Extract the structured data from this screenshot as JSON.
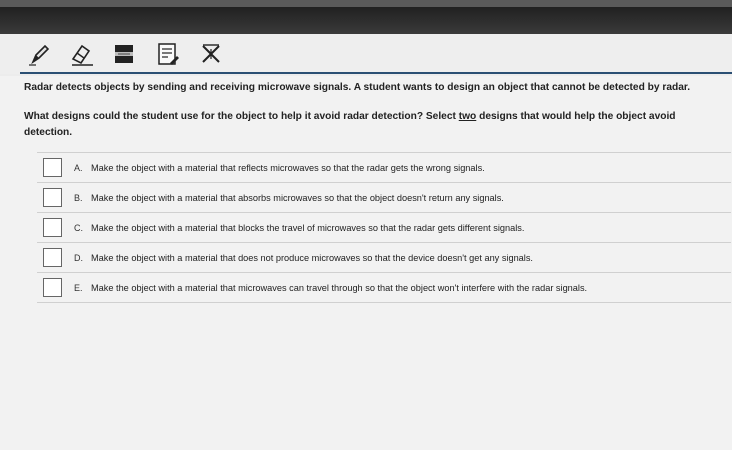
{
  "toolbar": {
    "tools": [
      {
        "icon": "pencil-icon"
      },
      {
        "icon": "eraser-icon"
      },
      {
        "icon": "line-reader-icon"
      },
      {
        "icon": "notepad-icon"
      },
      {
        "icon": "answer-eliminator-icon"
      }
    ]
  },
  "question": {
    "stem": "Radar detects objects by sending and receiving microwave signals. A student wants to design an object that cannot be detected by radar.",
    "prompt_before": "What designs could the student use for the object to help it avoid radar detection? Select ",
    "prompt_emphasis": "two",
    "prompt_after": " designs that would help the object avoid detection.",
    "options": [
      {
        "letter": "A.",
        "text": "Make the object with a material that reflects microwaves so that the radar gets the wrong signals."
      },
      {
        "letter": "B.",
        "text": "Make the object with a material that absorbs microwaves so that the object doesn't return any signals."
      },
      {
        "letter": "C.",
        "text": "Make the object with a material that blocks the travel of microwaves so that the radar gets different signals."
      },
      {
        "letter": "D.",
        "text": "Make the object with a material that does not produce microwaves so that the device doesn't get any signals."
      },
      {
        "letter": "E.",
        "text": "Make the object with a material that microwaves can travel through so that the object won't interfere with the radar signals."
      }
    ]
  },
  "colors": {
    "rule": "#2b4f73",
    "background": "#f2f2f2"
  }
}
